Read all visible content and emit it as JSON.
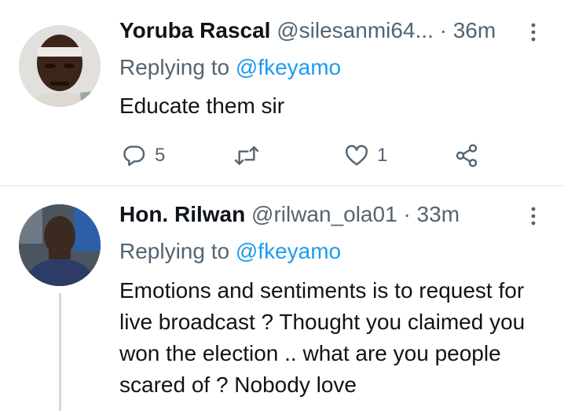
{
  "tweets": [
    {
      "author_name": "Yoruba Rascal",
      "handle": "@silesanmi64...",
      "separator": "·",
      "time": "36m",
      "replying_prefix": "Replying to",
      "replying_to": "@fkeyamo",
      "text": "Educate them sir",
      "reply_count": "5",
      "like_count": "1",
      "icons": [
        "reply-icon",
        "retweet-icon",
        "like-icon",
        "share-icon",
        "more-icon"
      ]
    },
    {
      "author_name": "Hon. Rilwan",
      "handle": "@rilwan_ola01",
      "separator": "·",
      "time": "33m",
      "replying_prefix": "Replying to",
      "replying_to": "@fkeyamo",
      "text": "Emotions and sentiments is to request for live broadcast ? Thought you claimed you won the election .. what are you people scared of ? Nobody love",
      "icons": [
        "more-icon"
      ]
    }
  ],
  "colors": {
    "accent": "#1d9bf0",
    "text_primary": "#0f1419",
    "text_secondary": "#536471",
    "divider": "#e4e8eb",
    "thread_line": "#cfd9de"
  }
}
